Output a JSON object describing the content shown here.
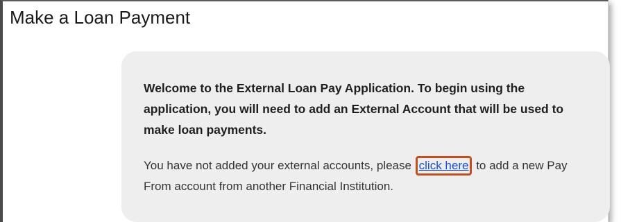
{
  "page": {
    "title": "Make a Loan Payment"
  },
  "panel": {
    "welcome_text": "Welcome to the External Loan Pay Application. To begin using the application, you will need to add an External Account that will be used to make loan payments.",
    "note_before": "You have not added your external accounts, please ",
    "link_label": "click here",
    "note_after": " to add a new Pay From account from another Financial Institution."
  },
  "colors": {
    "link": "#1a4fd6",
    "highlight_border": "#c0501f",
    "panel_background": "#eeeeee"
  }
}
